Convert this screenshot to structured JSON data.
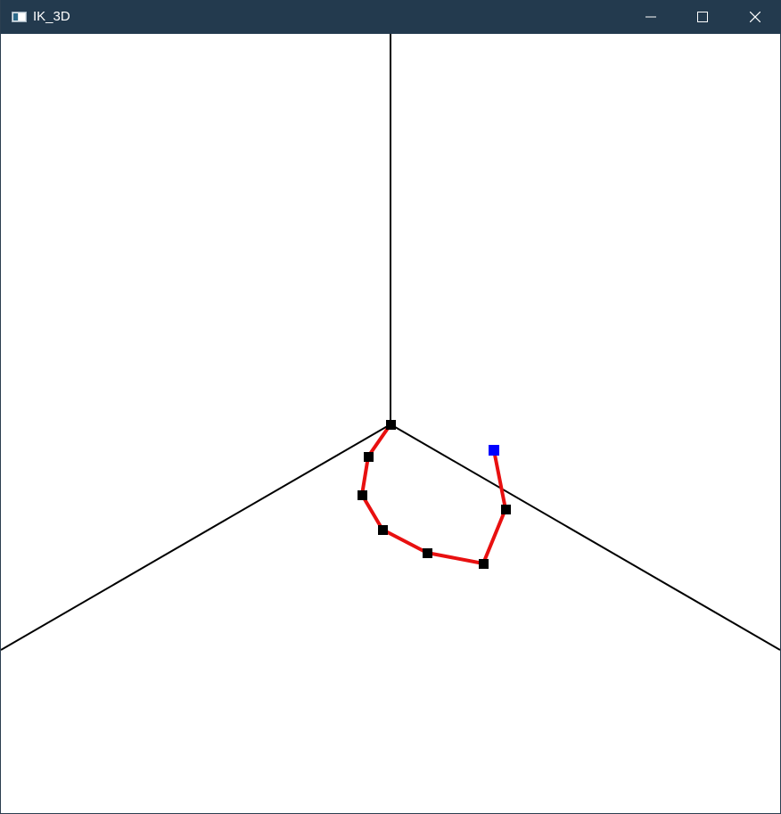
{
  "window": {
    "title": "IK_3D",
    "app_icon": "window-app-icon",
    "controls": {
      "minimize_icon": "minimize-icon",
      "maximize_icon": "maximize-icon",
      "close_icon": "close-icon"
    }
  },
  "scene": {
    "background_color": "#ffffff",
    "axis_color": "#000000",
    "chain_color": "#e81010",
    "joint_color": "#000000",
    "target_color": "#0000ff",
    "joint_count": 7,
    "target_count": 1
  }
}
